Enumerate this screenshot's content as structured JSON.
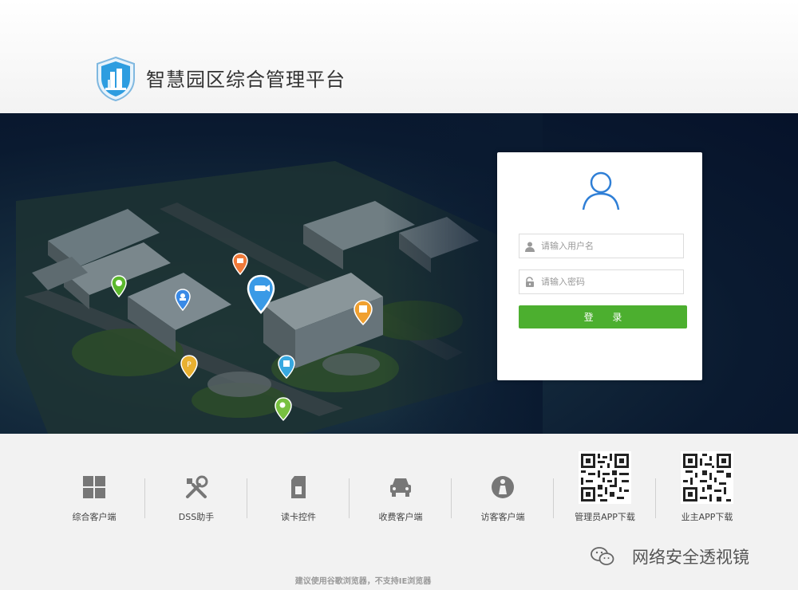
{
  "header": {
    "title": "智慧园区综合管理平台",
    "logo_icon": "shield-building-icon"
  },
  "login": {
    "avatar_icon": "user-avatar-icon",
    "username_placeholder": "请输入用户名",
    "password_placeholder": "请输入密码",
    "username_icon": "user-icon",
    "password_icon": "lock-icon",
    "submit_label": "登 录",
    "submit_color": "#4caf2f"
  },
  "downloads": [
    {
      "label": "综合客户端",
      "icon": "windows-icon"
    },
    {
      "label": "DSS助手",
      "icon": "tools-icon"
    },
    {
      "label": "读卡控件",
      "icon": "sd-card-icon"
    },
    {
      "label": "收费客户端",
      "icon": "car-icon"
    },
    {
      "label": "访客客户端",
      "icon": "visitor-icon"
    },
    {
      "label": "管理员APP下载",
      "icon": "qr-code-icon"
    },
    {
      "label": "业主APP下载",
      "icon": "qr-code-icon"
    }
  ],
  "footer": {
    "browser_note": "建议使用谷歌浏览器，不支持IE浏览器",
    "watermark": "网络安全透视镜",
    "watermark_icon": "wechat-icon"
  },
  "hero": {
    "map_pins": [
      {
        "icon": "pin-green-icon",
        "color": "#5cb82e"
      },
      {
        "icon": "pin-orange-icon",
        "color": "#f07a3a"
      },
      {
        "icon": "pin-blue-icon",
        "color": "#3a8ae6"
      },
      {
        "icon": "pin-camera-icon",
        "color": "#3a9ae6"
      },
      {
        "icon": "pin-amber-icon",
        "color": "#f0a030"
      },
      {
        "icon": "pin-parking-icon",
        "color": "#e8b030"
      },
      {
        "icon": "pin-light-blue-icon",
        "color": "#38a8e0"
      },
      {
        "icon": "pin-lime-icon",
        "color": "#78c040"
      }
    ]
  }
}
